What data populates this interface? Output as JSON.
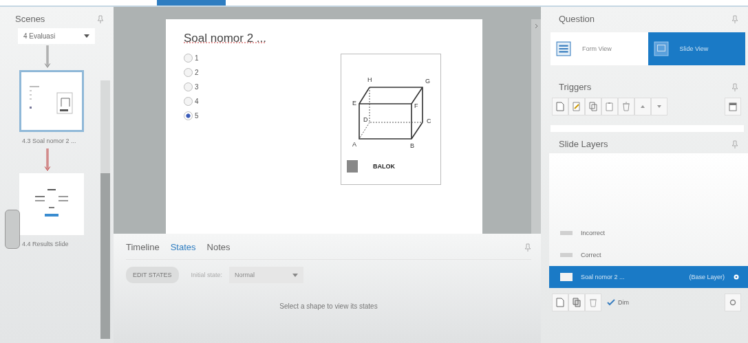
{
  "scenes": {
    "title": "Scenes",
    "dropdown": "4 Evaluasi",
    "slides": [
      {
        "label": "4.3 Soal nomor 2 ...",
        "selected": true,
        "kind": "question"
      },
      {
        "label": "4.4 Results Slide",
        "selected": false,
        "kind": "results"
      }
    ]
  },
  "slide": {
    "title": "Soal nomor 2 ...",
    "options": [
      {
        "label": "1",
        "selected": false
      },
      {
        "label": "2",
        "selected": false
      },
      {
        "label": "3",
        "selected": false
      },
      {
        "label": "4",
        "selected": false
      },
      {
        "label": "5",
        "selected": true
      }
    ],
    "figure": {
      "vertices": [
        "H",
        "G",
        "E",
        "F",
        "D",
        "C",
        "A",
        "B"
      ],
      "caption": "BALOK"
    }
  },
  "bottom_panel": {
    "tabs": [
      {
        "label": "Timeline",
        "selected": false
      },
      {
        "label": "States",
        "selected": true
      },
      {
        "label": "Notes",
        "selected": false
      }
    ],
    "edit_button": "EDIT STATES",
    "initial_state_label": "Initial state:",
    "initial_state_value": "Normal",
    "empty_message": "Select a shape to view its states"
  },
  "question_panel": {
    "title": "Question",
    "views": [
      {
        "label": "Form View",
        "selected": false,
        "kind": "form"
      },
      {
        "label": "Slide View",
        "selected": true,
        "kind": "slide"
      }
    ]
  },
  "triggers_panel": {
    "title": "Triggers"
  },
  "layers_panel": {
    "title": "Slide Layers",
    "layers": [
      {
        "label": "Incorrect",
        "selected": false
      },
      {
        "label": "Correct",
        "selected": false
      },
      {
        "label": "Soal nomor 2 ...",
        "note": "(Base Layer)",
        "selected": true
      }
    ],
    "dim": {
      "label": "Dim",
      "checked": true
    }
  }
}
